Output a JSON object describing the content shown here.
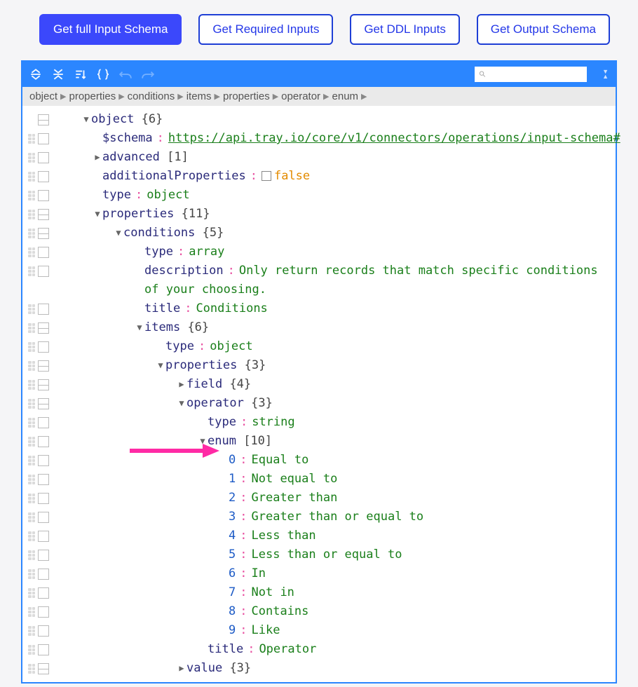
{
  "buttons": {
    "full_schema": "Get full Input Schema",
    "required": "Get Required Inputs",
    "ddl": "Get DDL Inputs",
    "output_schema": "Get Output Schema"
  },
  "search": {
    "placeholder": ""
  },
  "breadcrumb": [
    "object",
    "properties",
    "conditions",
    "items",
    "properties",
    "operator",
    "enum"
  ],
  "tree": {
    "root_label": "object",
    "root_count": "{6}",
    "schema_key": "$schema",
    "schema_val": "https://api.tray.io/core/v1/connectors/operations/input-schema#",
    "advanced_key": "advanced",
    "advanced_count": "[1]",
    "addprops_key": "additionalProperties",
    "addprops_val": "false",
    "type_key": "type",
    "type_val": "object",
    "properties_key": "properties",
    "properties_count": "{11}",
    "conditions_key": "conditions",
    "conditions_count": "{5}",
    "cond_type_key": "type",
    "cond_type_val": "array",
    "cond_desc_key": "description",
    "cond_desc_val": "Only return records that match specific conditions of your choosing.",
    "cond_title_key": "title",
    "cond_title_val": "Conditions",
    "items_key": "items",
    "items_count": "{6}",
    "items_type_key": "type",
    "items_type_val": "object",
    "items_props_key": "properties",
    "items_props_count": "{3}",
    "field_key": "field",
    "field_count": "{4}",
    "operator_key": "operator",
    "operator_count": "{3}",
    "op_type_key": "type",
    "op_type_val": "string",
    "enum_key": "enum",
    "enum_count": "[10]",
    "enum": [
      {
        "idx": "0",
        "val": "Equal to"
      },
      {
        "idx": "1",
        "val": "Not equal to"
      },
      {
        "idx": "2",
        "val": "Greater than"
      },
      {
        "idx": "3",
        "val": "Greater than or equal to"
      },
      {
        "idx": "4",
        "val": "Less than"
      },
      {
        "idx": "5",
        "val": "Less than or equal to"
      },
      {
        "idx": "6",
        "val": "In"
      },
      {
        "idx": "7",
        "val": "Not in"
      },
      {
        "idx": "8",
        "val": "Contains"
      },
      {
        "idx": "9",
        "val": "Like"
      }
    ],
    "op_title_key": "title",
    "op_title_val": "Operator",
    "value_key": "value",
    "value_count": "{3}"
  }
}
